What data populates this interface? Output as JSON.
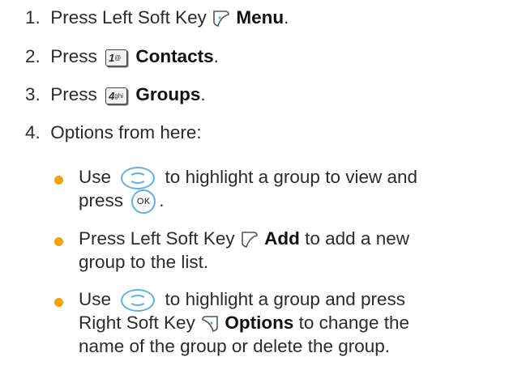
{
  "steps": [
    {
      "num": "1.",
      "pre": "Press Left Soft Key",
      "bold": "Menu",
      "post": "."
    },
    {
      "num": "2.",
      "pre": "Press",
      "key_main": "1",
      "key_sub": "@",
      "bold": "Contacts",
      "post": "."
    },
    {
      "num": "3.",
      "pre": "Press",
      "key_main": "4",
      "key_sub": "ghi",
      "bold": "Groups",
      "post": "."
    },
    {
      "num": "4.",
      "text": "Options from here:"
    }
  ],
  "options": [
    {
      "pre": "Use",
      "mid": "to highlight a group to view and",
      "cont_pre": "press",
      "ok_label": "OK",
      "cont_post": "."
    },
    {
      "pre": "Press Left Soft Key",
      "bold": "Add",
      "post": "to add a new",
      "cont": "group to the list."
    },
    {
      "pre": "Use",
      "mid": "to highlight a group and press",
      "cont1_pre": "Right Soft Key",
      "bold": "Options",
      "cont1_post": "to change the",
      "cont2": "name of the group or delete the group."
    }
  ],
  "icons": {
    "left_soft_key": "left-soft-key-icon",
    "right_soft_key": "right-soft-key-icon",
    "navigation_key": "navigation-key-icon",
    "ok_key": "ok-key-icon"
  },
  "colors": {
    "bullet": "#f5a100",
    "nav_key": "#5fb0e6"
  }
}
